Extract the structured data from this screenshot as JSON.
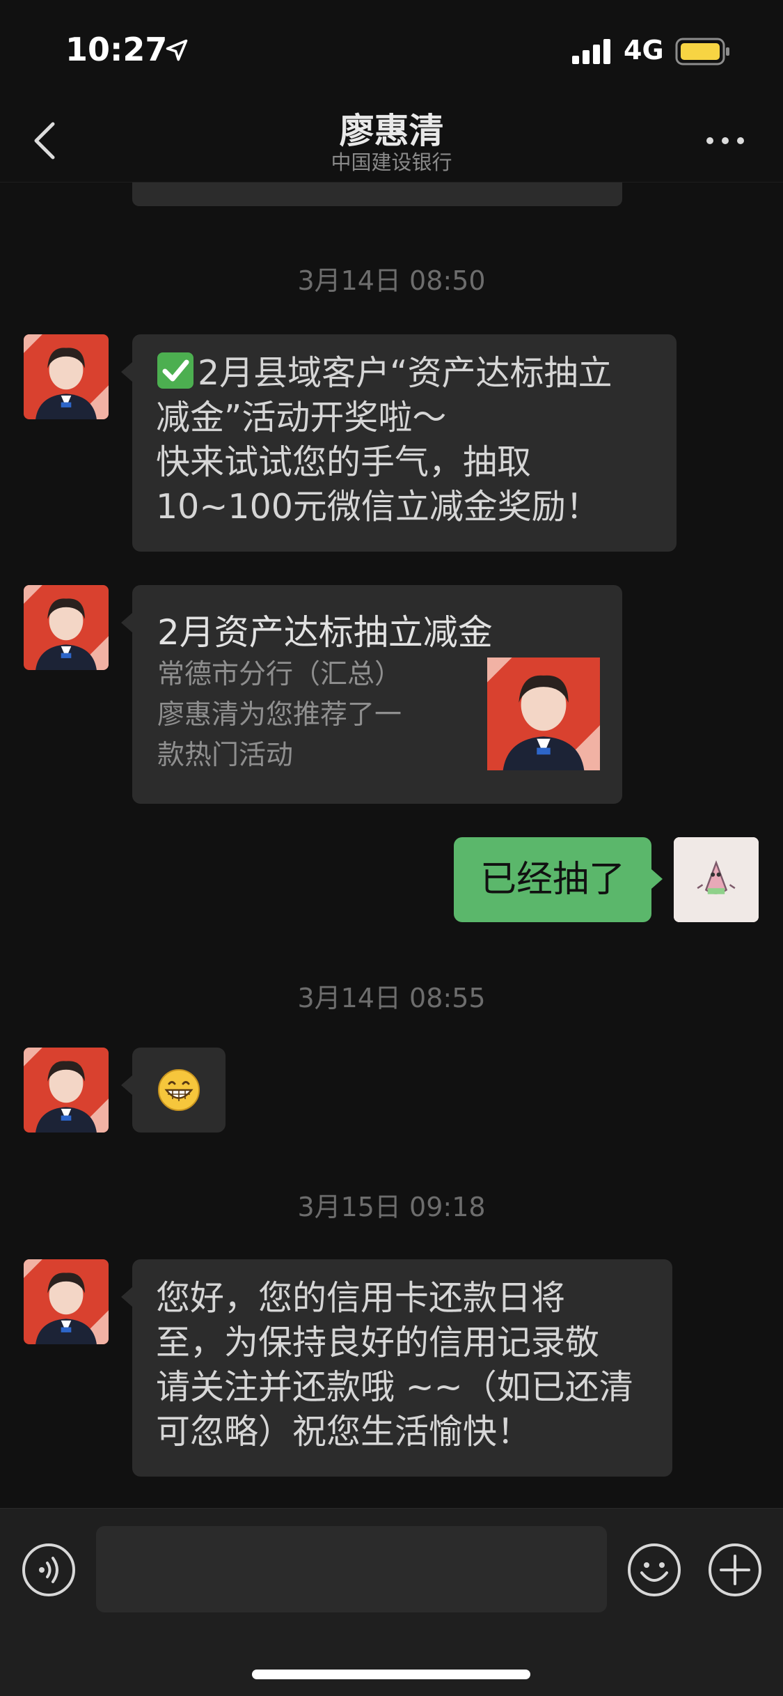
{
  "status_bar": {
    "time": "10:27",
    "network": "4G",
    "location_icon": "location-arrow-icon",
    "signal_icon": "cell-signal-icon",
    "battery_icon": "battery-icon"
  },
  "nav": {
    "title": "廖惠清",
    "subtitle": "中国建设银行",
    "back_icon": "chevron-left-icon",
    "more_icon": "more-dots-icon"
  },
  "chat": {
    "timestamps": [
      "3月14日 08:50",
      "3月14日 08:55",
      "3月15日 09:18"
    ],
    "message1": {
      "emoji": "check-mark-icon",
      "lines": [
        "2月县域客户“资产达标抽立",
        "减金”活动开奖啦～",
        "快来试试您的手气，抽取",
        "10~100元微信立减金奖励！"
      ]
    },
    "card": {
      "title": "2月资产达标抽立减金",
      "description_lines": [
        "常德市分行（汇总）",
        "廖惠清为您推荐了一",
        "款热门活动"
      ]
    },
    "my_message": "已经抽了",
    "emoji_message": "grinning-face-icon",
    "message4": {
      "lines": [
        "您好，您的信用卡还款日将",
        "至，为保持良好的信用记录敬",
        "请关注并还款哦 ~~（如已还清",
        "可忽略）祝您生活愉快！"
      ]
    }
  },
  "input_bar": {
    "voice_icon": "voice-icon",
    "emoji_icon": "smiley-icon",
    "plus_icon": "plus-icon"
  },
  "colors": {
    "background": "#111111",
    "bubble_in": "#2c2c2c",
    "bubble_out": "#5bb76b",
    "avatar_red": "#d9412f"
  }
}
